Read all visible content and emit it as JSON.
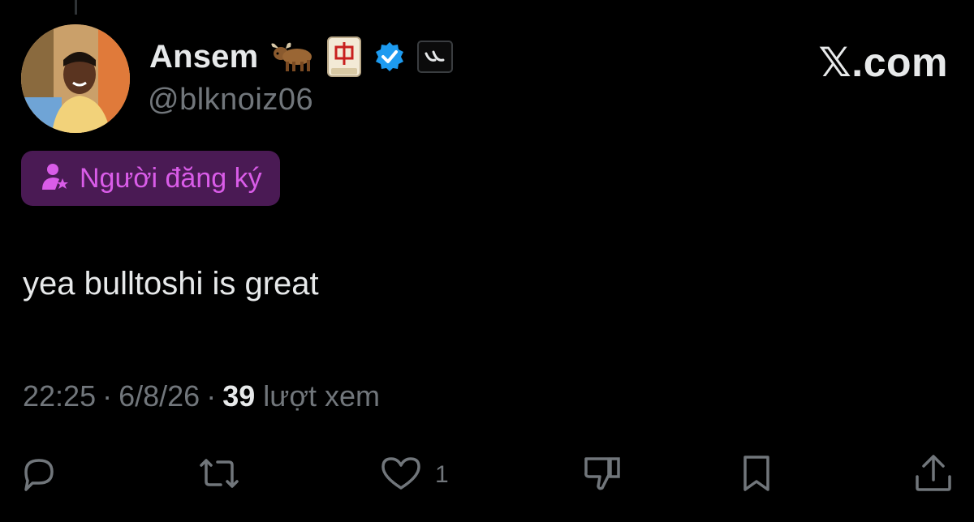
{
  "author": {
    "display_name": "Ansem",
    "handle": "@blknoiz06",
    "badges": [
      "ox-emoji",
      "mahjong-red-dragon-emoji",
      "verified-badge-icon",
      "affiliate-logo-icon"
    ]
  },
  "brand": "𝕏.com",
  "subscriber_badge": {
    "icon": "subscriber-star-icon",
    "label": "Người đăng ký"
  },
  "tweet": {
    "text": "yea bulltoshi is great"
  },
  "meta": {
    "time": "22:25",
    "date": "6/8/26",
    "separator": "·",
    "views_count": "39",
    "views_label": "lượt xem"
  },
  "actions": {
    "reply_icon": "reply-icon",
    "retweet_icon": "retweet-icon",
    "like_icon": "heart-icon",
    "like_count": "1",
    "dislike_icon": "thumbs-down-icon",
    "bookmark_icon": "bookmark-icon",
    "share_icon": "share-icon"
  },
  "colors": {
    "background": "#000000",
    "text_primary": "#e7e9ea",
    "text_secondary": "#71767b",
    "verified_blue": "#1d9bf0",
    "subscriber_bg": "#4a1a54",
    "subscriber_text": "#d95ce8"
  }
}
